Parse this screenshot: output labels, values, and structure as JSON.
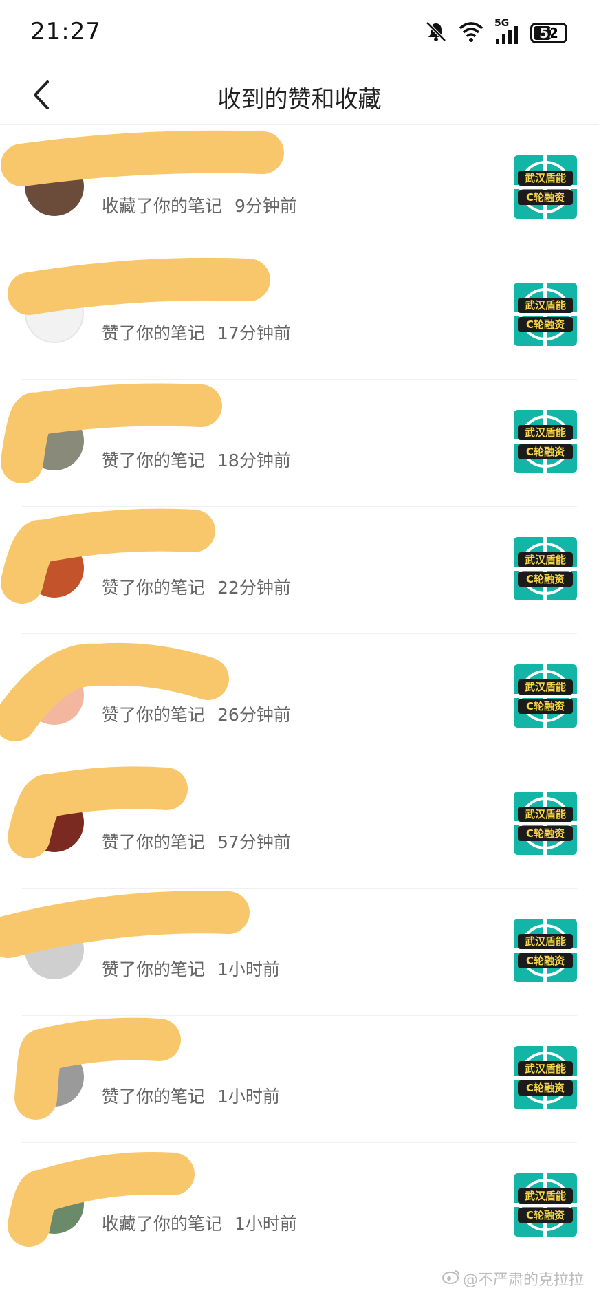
{
  "status_bar": {
    "time": "21:27",
    "icons": [
      "bell-mute-icon",
      "wifi-icon",
      "signal-5g-icon",
      "battery-icon"
    ],
    "network_label": "5G",
    "battery_level": "52"
  },
  "header": {
    "back_icon": "chevron-left-icon",
    "title": "收到的赞和收藏"
  },
  "notifications": [
    {
      "action": "收藏了你的笔记",
      "time": "9分钟前",
      "avatar_color": "#6b4c3b",
      "thumb_text": [
        "武汉盾能",
        "C轮融资"
      ]
    },
    {
      "action": "赞了你的笔记",
      "time": "17分钟前",
      "avatar_color": "#f2f2f2",
      "thumb_text": [
        "武汉盾能",
        "C轮融资"
      ]
    },
    {
      "action": "赞了你的笔记",
      "time": "18分钟前",
      "avatar_color": "#8a8a7a",
      "thumb_text": [
        "武汉盾能",
        "C轮融资"
      ]
    },
    {
      "action": "赞了你的笔记",
      "time": "22分钟前",
      "avatar_color": "#c2532a",
      "thumb_text": [
        "武汉盾能",
        "C轮融资"
      ]
    },
    {
      "action": "赞了你的笔记",
      "time": "26分钟前",
      "avatar_color": "#f3b7a0",
      "thumb_text": [
        "武汉盾能",
        "C轮融资"
      ]
    },
    {
      "action": "赞了你的笔记",
      "time": "57分钟前",
      "avatar_color": "#7a2a20",
      "thumb_text": [
        "武汉盾能",
        "C轮融资"
      ]
    },
    {
      "action": "赞了你的笔记",
      "time": "1小时前",
      "avatar_color": "#cfcfcf",
      "thumb_text": [
        "武汉盾能",
        "C轮融资"
      ]
    },
    {
      "action": "赞了你的笔记",
      "time": "1小时前",
      "avatar_color": "#9a9a9a",
      "thumb_text": [
        "武汉盾能",
        "C轮融资"
      ]
    },
    {
      "action": "收藏了你的笔记",
      "time": "1小时前",
      "avatar_color": "#6a8a6a",
      "thumb_text": [
        "武汉盾能",
        "C轮融资"
      ]
    }
  ],
  "redaction_color": "#f9c76b",
  "watermark": "@不严肃的克拉拉"
}
